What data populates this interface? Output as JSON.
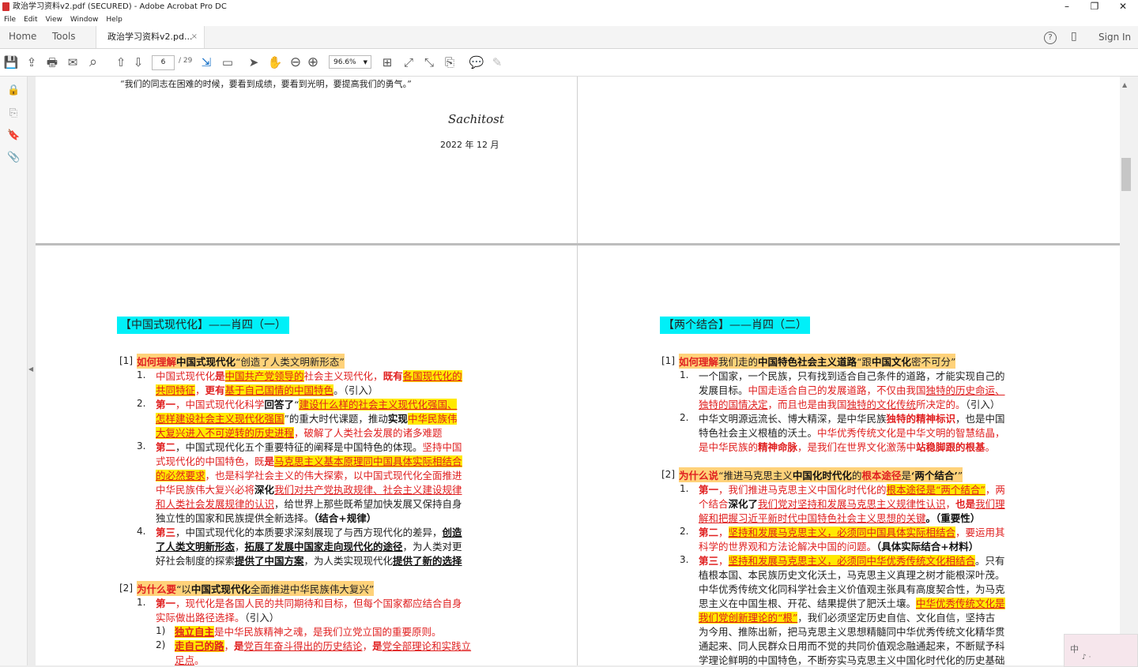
{
  "window": {
    "title": "政治学习资料v2.pdf (SECURED) - Adobe Acrobat Pro DC",
    "controls": {
      "minimize": "–",
      "maximize": "❐",
      "close": "✕"
    }
  },
  "menu": [
    "File",
    "Edit",
    "View",
    "Window",
    "Help"
  ],
  "tabs": {
    "home": "Home",
    "tools": "Tools",
    "doc": "政治学习资料v2.pd...",
    "close": "×",
    "signin": "Sign In"
  },
  "toolbar": {
    "page": "6",
    "total": "/ 29",
    "zoom": "96.6%"
  },
  "icons": {
    "save": "💾",
    "upload": "⇪",
    "print": "🖶",
    "mail": "✉",
    "search": "⌕",
    "prev": "⇧",
    "next": "⇩",
    "fit": "⇲",
    "pages": "▭",
    "select": "➤",
    "hand": "✋",
    "zoomout": "⊖",
    "zoomin": "⊕",
    "tool1": "⊞",
    "tool2": "⤢",
    "tool3": "⤡",
    "tool4": "⎘",
    "comment": "💬",
    "sign": "✎",
    "help": "?",
    "mobile": "▯",
    "lock": "🔒",
    "copy": "⎘",
    "bookmark": "🔖",
    "attach": "📎",
    "left": "◀",
    "up": "▲"
  },
  "page_top": {
    "quote": "“我们的同志在困难的时候，要看到成绩，要看到光明，要提高我们的勇气。”",
    "signature": "Sachitost",
    "date": "2022 年 12 月"
  },
  "left_page": {
    "heading": "【中国式现代化】——肖四（一）",
    "q1": {
      "tag": "[1]",
      "a": "如何理解",
      "b": "中国式现代化",
      "c": "“创造了人类文明新形态”"
    },
    "i1": {
      "n": "1.",
      "a": "中国式现代化",
      "b": "是",
      "c": "中国共产党领导的",
      "d": "社会主义现代化，",
      "e": "既有",
      "f": "各国现代化的",
      "g": "共同特征",
      "h": "，",
      "i": "更有",
      "j": "基于自己国情的中国特色",
      "k": "。（引入）"
    },
    "i2": {
      "n": "2.",
      "a": "第一",
      "b": "，中国式现代化科学",
      "c": "回答了",
      "d": "“",
      "e": "建设什么样的社会主义现代化强国、",
      "f": "怎样建设社会主义现代化强国",
      "g": "”的重大时代课题，推动",
      "h": "实现",
      "i": "中华民族伟",
      "j": "大复兴进入不可逆转的历史进程",
      "k": "，破解了人类社会发展的诸多难题"
    },
    "i3": {
      "n": "3.",
      "a": "第二",
      "b": "，中国式现代化五个重要特征的阐释是中国特色的体现。",
      "c": "坚持中国",
      "d": "式现代化的中国特色，既",
      "e": "是",
      "f": "马克思主义基本原理同中国具体实际相结合",
      "g": "的必然要求",
      "h": "，也是科学社会主义的伟大探索，以中国式现代化全面推进",
      "i": "中华民族伟大复兴必将",
      "j": "深化",
      "k": "我们对共产党执政规律、社会主义建设规律",
      "l": "和人类社会发展规律的认识",
      "m": "，给世界上那些既希望加快发展又保持自身",
      "n2": "独立性的国家和民族提供全新选择。",
      "o": "（结合+规律）"
    },
    "i4": {
      "n": "4.",
      "a": "第三",
      "b": "，中国式现代化的本质要求深刻展现了与西方现代化的差异，",
      "c": "创造",
      "d": "了人类文明新形态",
      "e": "，",
      "f": "拓展了发展中国家走向现代化的途径",
      "g": "，为人类对更",
      "h": "好社会制度的探索",
      "i": "提供了中国方案",
      "j": "，为人类实现现代化",
      "k": "提供了新的选择"
    },
    "q2": {
      "tag": "[2]",
      "a": "为什么要",
      "b": "“以",
      "c": "中国式现代化",
      "d": "全面推进中华民族伟大复兴”"
    },
    "j1": {
      "n": "1.",
      "a": "第一",
      "b": "，现代化是各国人民的共同期待和目标，但每个国家都应结合自身",
      "c": "实际做出路径选择。",
      "d": "（引入）"
    },
    "s1": {
      "n": "1)",
      "a": "独立自主",
      "b": "是中华民族精神之魂，是我们立党立国的重要原则。"
    },
    "s2": {
      "n": "2)",
      "a": "走自己的路",
      "b": "，",
      "c": "是",
      "d": "党百年奋斗得出的历史结论",
      "e": "，",
      "f": "是",
      "g": "党全部理论和实践立",
      "h": "足点",
      "i": "。"
    }
  },
  "right_page": {
    "heading": "【两个结合】——肖四（二）",
    "q1": {
      "tag": "[1]",
      "a": "如何理解",
      "b": "我们走的",
      "c": "中国特色社会主义道路",
      "d": "“跟",
      "e": "中国文化",
      "f": "密不可分”"
    },
    "i1": {
      "n": "1.",
      "a": "一个国家，一个民族，只有找到适合自己条件的道路，才能实现自己的",
      "b": "发展目标。",
      "c": "中国走适合自己的发展道路，不仅由我国",
      "d": "独特的历史命运、",
      "e": "独特的国情决定",
      "f": "，而且也是由我国",
      "g": "独特的文化传统",
      "h": "所决定的。",
      "i": "（引入）"
    },
    "i2": {
      "n": "2.",
      "a": "中华文明源远流长、博大精深，是中华民族",
      "b": "独特的精神标识",
      "c": "，也是中国",
      "d": "特色社会主义根植的沃土。",
      "e": "中华优秀传统文化是中华文明的智慧结晶，",
      "f": "是中华民族的",
      "g": "精神命脉",
      "h": "，是我们在世界文化激荡中",
      "i": "站稳脚跟的根基",
      "j": "。"
    },
    "q2": {
      "tag": "[2]",
      "a": "为什么说",
      "b": "“推进马克思主义",
      "c": "中国化时代化",
      "d": "的",
      "e": "根本途径",
      "f": "是",
      "g": "‘两个结合’",
      "h": "”"
    },
    "j1": {
      "n": "1.",
      "a": "第一",
      "b": "，我们推进马克思主义中国化时代化的",
      "c": "根本途径是“两个结合”",
      "d": "，两",
      "e": "个结合",
      "f": "深化了",
      "g": "我们党对坚持和发展马克思主义规律性认识",
      "h": "，",
      "i": "也是",
      "j": "我们理",
      "k": "解和把握习近平新时代中国特色社会主义思想的关键",
      "l": "。（重要性）"
    },
    "j2": {
      "n": "2.",
      "a": "第二",
      "b": "，",
      "c": "坚持和发展马克思主义，必须同中国具体实际相结合",
      "d": "，要运用其",
      "e": "科学的世界观和方法论解决中国的问题。",
      "f": "（具体实际结合+材料）"
    },
    "j3": {
      "n": "3.",
      "a": "第三",
      "b": "，",
      "c": "坚持和发展马克思主义，必须同中华优秀传统文化相结合",
      "d": "。只有",
      "e": "植根本国、本民族历史文化沃土，马克思主义真理之树才能根深叶茂。",
      "f": "中华优秀传统文化同科学社会主义价值观主张具有高度契合性，为马克",
      "g": "思主义在中国生根、开花、结果提供了肥沃土壤。",
      "h": "中华优秀传统文化是",
      "i": "我们党创新理论的“根”",
      "j": "，我们必须坚定历史自信、文化自信，坚持古",
      "k": "为今用、推陈出新，把马克思主义思想精髓同中华优秀传统文化精华贯",
      "l": "通起来、同人民群众日用而不觉的共同价值观念融通起来，不断赋予科",
      "m": "学理论鲜明的中国特色，不断夯实马克思主义中国化时代化的历史基础"
    }
  },
  "widget": {
    "text": "中",
    "sub": "♪ ·"
  }
}
